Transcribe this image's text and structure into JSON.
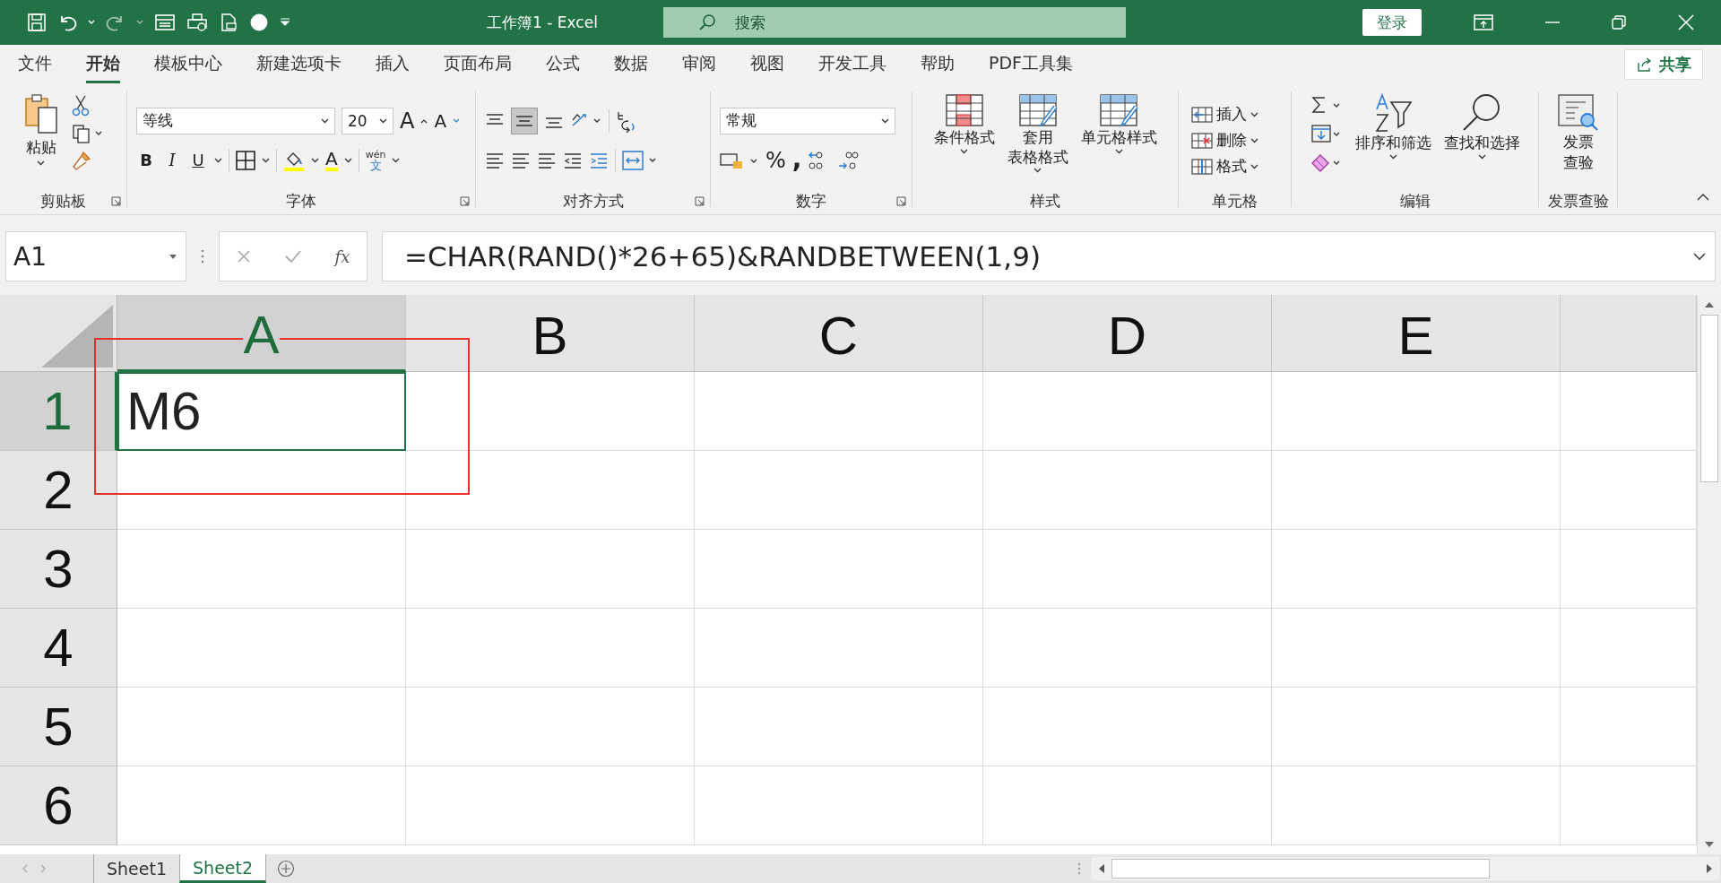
{
  "window": {
    "title": "工作簿1  -  Excel"
  },
  "search": {
    "placeholder": "搜索"
  },
  "login": "登录",
  "menu_tabs": [
    {
      "label": "文件",
      "selected": false
    },
    {
      "label": "开始",
      "selected": true
    },
    {
      "label": "模板中心",
      "selected": false
    },
    {
      "label": "新建选项卡",
      "selected": false
    },
    {
      "label": "插入",
      "selected": false
    },
    {
      "label": "页面布局",
      "selected": false
    },
    {
      "label": "公式",
      "selected": false
    },
    {
      "label": "数据",
      "selected": false
    },
    {
      "label": "审阅",
      "selected": false
    },
    {
      "label": "视图",
      "selected": false
    },
    {
      "label": "开发工具",
      "selected": false
    },
    {
      "label": "帮助",
      "selected": false
    },
    {
      "label": "PDF工具集",
      "selected": false
    }
  ],
  "share": "共享",
  "ribbon": {
    "clipboard": {
      "paste": "粘贴",
      "label": "剪贴板"
    },
    "font": {
      "name": "等线",
      "size": "20",
      "grow": "A",
      "shrink": "A",
      "styles": [
        "B",
        "I",
        "U"
      ],
      "font_color_button": "A",
      "phonetic_top": "wén",
      "phonetic_bottom": "文",
      "label": "字体"
    },
    "alignment": {
      "label": "对齐方式"
    },
    "number": {
      "format": "常规",
      "percent": "%",
      "comma": ",",
      "label": "数字"
    },
    "styles": {
      "buttons": [
        [
          "条件格式"
        ],
        [
          "套用",
          "表格格式"
        ],
        [
          "单元格样式"
        ]
      ],
      "label": "样式"
    },
    "cells": {
      "buttons": [
        "插入",
        "删除",
        "格式"
      ],
      "label": "单元格"
    },
    "editing": {
      "buttons": [
        "排序和筛选",
        "查找和选择"
      ],
      "label": "编辑"
    },
    "invoice": {
      "button": [
        "发票",
        "查验"
      ],
      "label": "发票查验"
    }
  },
  "formula_bar": {
    "name_box": "A1",
    "fx": "fx",
    "formula": "=CHAR(RAND()*26+65)&RANDBETWEEN(1,9)"
  },
  "grid": {
    "columns": [
      {
        "label": "A",
        "selected": true
      },
      {
        "label": "B",
        "selected": false
      },
      {
        "label": "C",
        "selected": false
      },
      {
        "label": "D",
        "selected": false
      },
      {
        "label": "E",
        "selected": false
      }
    ],
    "rows": [
      {
        "label": "1",
        "selected": true,
        "cells": [
          {
            "value": "M6"
          }
        ]
      },
      {
        "label": "2",
        "selected": false
      },
      {
        "label": "3",
        "selected": false
      },
      {
        "label": "4",
        "selected": false
      },
      {
        "label": "5",
        "selected": false
      },
      {
        "label": "6",
        "selected": false
      }
    ]
  },
  "sheets": [
    {
      "name": "Sheet1",
      "selected": false
    },
    {
      "name": "Sheet2",
      "selected": true
    }
  ]
}
